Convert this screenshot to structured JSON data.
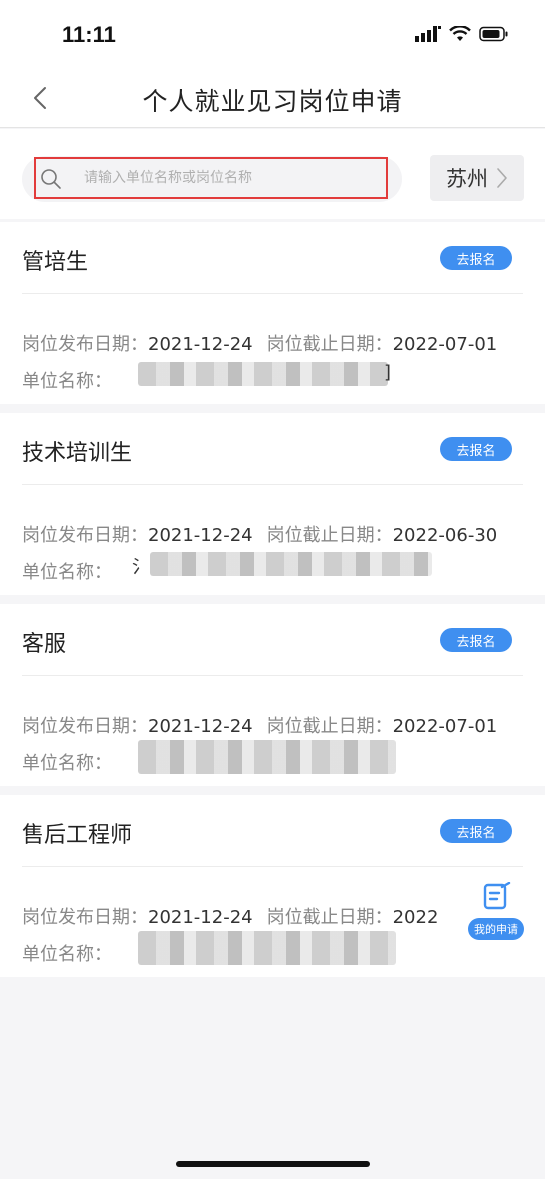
{
  "status_bar": {
    "time": "11:11"
  },
  "nav": {
    "title": "个人就业见习岗位申请"
  },
  "search": {
    "placeholder": "请输入单位名称或岗位名称",
    "value": ""
  },
  "city": {
    "label": "苏州"
  },
  "jobs": [
    {
      "title": "管培生",
      "apply_label": "去报名",
      "publish_label": "岗位发布日期：",
      "publish_date": "2021-12-24",
      "deadline_label": "岗位截止日期：",
      "deadline_date": "2022-07-01",
      "unit_label": "单位名称：",
      "unit_visible_fragment": "]"
    },
    {
      "title": "技术培训生",
      "apply_label": "去报名",
      "publish_label": "岗位发布日期：",
      "publish_date": "2021-12-24",
      "deadline_label": "岗位截止日期：",
      "deadline_date": "2022-06-30",
      "unit_label": "单位名称：",
      "unit_visible_fragment": "氵"
    },
    {
      "title": "客服",
      "apply_label": "去报名",
      "publish_label": "岗位发布日期：",
      "publish_date": "2021-12-24",
      "deadline_label": "岗位截止日期：",
      "deadline_date": "2022-07-01",
      "unit_label": "单位名称：",
      "unit_visible_fragment": ""
    },
    {
      "title": "售后工程师",
      "apply_label": "去报名",
      "publish_label": "岗位发布日期：",
      "publish_date": "2021-12-24",
      "deadline_label": "岗位截止日期：",
      "deadline_date": "2022",
      "unit_label": "单位名称：",
      "unit_visible_fragment": ""
    }
  ],
  "fab": {
    "label": "我的申请",
    "icon": "edit-doc-icon"
  },
  "colors": {
    "accent": "#3f8ff0",
    "highlight_border": "#e23b3b",
    "background": "#f5f5f7"
  }
}
